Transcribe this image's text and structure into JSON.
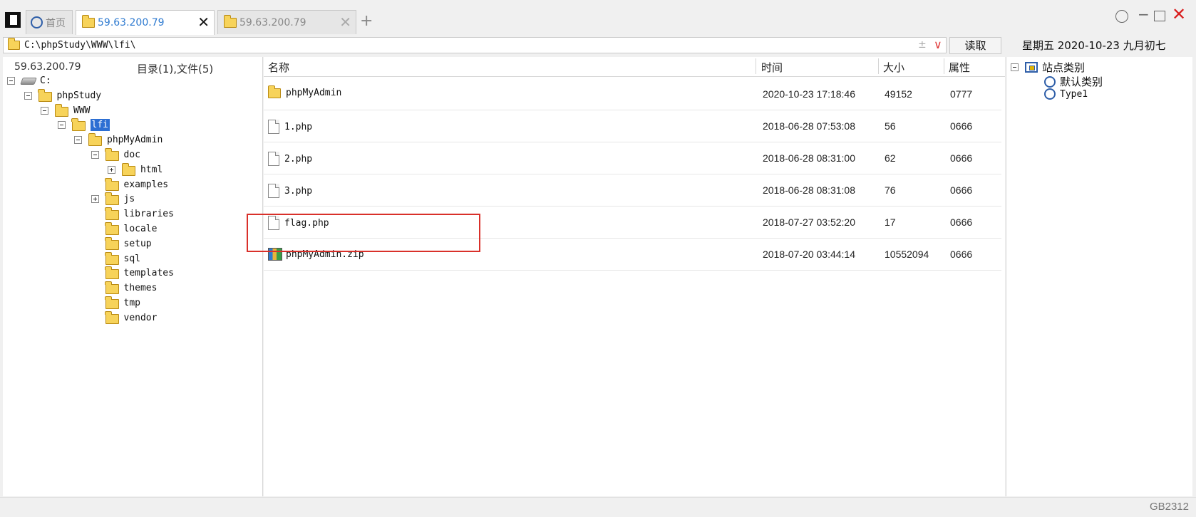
{
  "tabs": [
    {
      "label": "首页",
      "icon": "circle-icon",
      "active": false
    },
    {
      "label": "59.63.200.79",
      "icon": "folder-icon",
      "active": true
    },
    {
      "label": "59.63.200.79",
      "icon": "folder-icon",
      "active": false
    }
  ],
  "tabbar": {
    "add_label": "+",
    "close_label": "✕"
  },
  "window_controls": {
    "minimize": "−",
    "close": "✕"
  },
  "address": {
    "path": "C:\\phpStudy\\WWW\\lfi\\",
    "pm_symbol": "±",
    "dropdown_symbol": "∨"
  },
  "read_button": "读取",
  "date_text": "星期五  2020-10-23  九月初七",
  "left_panel": {
    "host": "59.63.200.79",
    "summary": "目录(1),文件(5)",
    "tree": [
      {
        "label": "C:",
        "type": "drive",
        "expander": "minus"
      },
      {
        "label": "phpStudy",
        "type": "folder",
        "expander": "minus"
      },
      {
        "label": "WWW",
        "type": "folder",
        "expander": "minus"
      },
      {
        "label": "lfi",
        "type": "folder",
        "expander": "minus",
        "selected": true
      },
      {
        "label": "phpMyAdmin",
        "type": "folder",
        "expander": "minus"
      },
      {
        "label": "doc",
        "type": "folder",
        "expander": "minus"
      },
      {
        "label": "html",
        "type": "folder",
        "expander": "plus"
      },
      {
        "label": "examples",
        "type": "folder",
        "expander": "none"
      },
      {
        "label": "js",
        "type": "folder",
        "expander": "plus"
      },
      {
        "label": "libraries",
        "type": "folder",
        "expander": "none"
      },
      {
        "label": "locale",
        "type": "folder",
        "expander": "none"
      },
      {
        "label": "setup",
        "type": "folder",
        "expander": "none"
      },
      {
        "label": "sql",
        "type": "folder",
        "expander": "none"
      },
      {
        "label": "templates",
        "type": "folder",
        "expander": "none"
      },
      {
        "label": "themes",
        "type": "folder",
        "expander": "none"
      },
      {
        "label": "tmp",
        "type": "folder",
        "expander": "none"
      },
      {
        "label": "vendor",
        "type": "folder",
        "expander": "none"
      }
    ]
  },
  "file_list": {
    "columns": {
      "name": "名称",
      "time": "时间",
      "size": "大小",
      "attr": "属性"
    },
    "files": [
      {
        "name": "phpMyAdmin",
        "type": "folder",
        "time": "2020-10-23 17:18:46",
        "size": "49152",
        "attr": "0777"
      },
      {
        "name": "1.php",
        "type": "file",
        "time": "2018-06-28 07:53:08",
        "size": "56",
        "attr": "0666"
      },
      {
        "name": "2.php",
        "type": "file",
        "time": "2018-06-28 08:31:00",
        "size": "62",
        "attr": "0666"
      },
      {
        "name": "3.php",
        "type": "file",
        "time": "2018-06-28 08:31:08",
        "size": "76",
        "attr": "0666"
      },
      {
        "name": "flag.php",
        "type": "file",
        "time": "2018-07-27 03:52:20",
        "size": "17",
        "attr": "0666"
      },
      {
        "name": "phpMyAdmin.zip",
        "type": "zip",
        "time": "2018-07-20 03:44:14",
        "size": "10552094",
        "attr": "0666"
      }
    ],
    "highlight_color": "#d9302a"
  },
  "site_panel": {
    "root": "站点类别",
    "items": [
      "默认类别",
      "Type1"
    ]
  },
  "status": {
    "encoding": "GB2312"
  }
}
